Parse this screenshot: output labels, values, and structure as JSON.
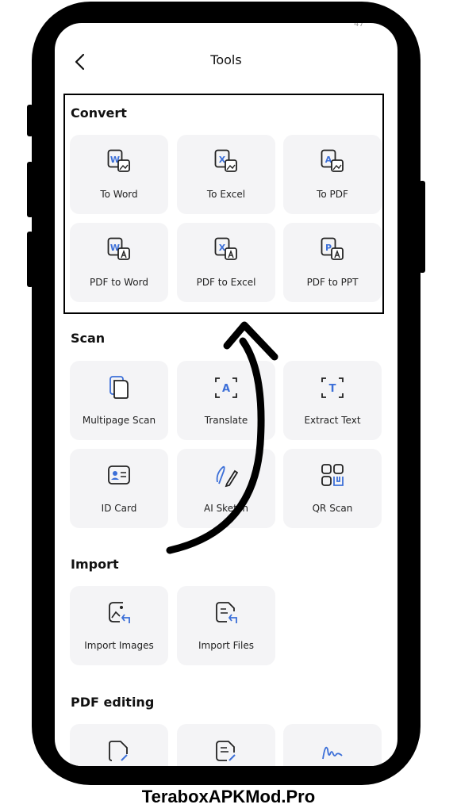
{
  "header": {
    "title": "Tools",
    "status_fragment": "47"
  },
  "sections": {
    "convert": {
      "title": "Convert",
      "items": [
        "To Word",
        "To Excel",
        "To PDF",
        "PDF to Word",
        "PDF to Excel",
        "PDF to PPT"
      ]
    },
    "scan": {
      "title": "Scan",
      "items": [
        "Multipage Scan",
        "Translate",
        "Extract Text",
        "ID Card",
        "AI Sketch",
        "QR Scan"
      ]
    },
    "import": {
      "title": "Import",
      "items": [
        "Import Images",
        "Import Files"
      ]
    },
    "pdf_editing": {
      "title": "PDF editing"
    }
  },
  "icons": {
    "glyphs": {
      "word": "W",
      "excel": "X",
      "pdf": "A",
      "ppt": "P",
      "text": "T",
      "translate": "A"
    }
  },
  "colors": {
    "accent": "#3c6fd8",
    "icon": "#222222",
    "tile_bg": "#f4f4f6"
  },
  "watermark": "TeraboxAPKMod.Pro"
}
